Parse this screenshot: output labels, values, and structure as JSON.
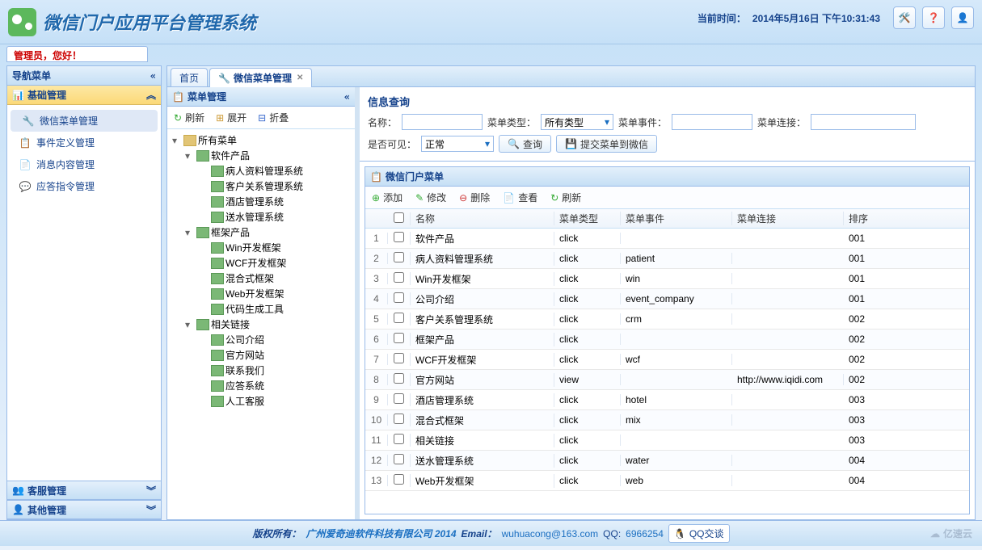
{
  "header": {
    "title": "微信门户应用平台管理系统",
    "time_label": "当前时间：",
    "time_value": "2014年5月16日 下午10:31:43",
    "icons": [
      "tools-icon",
      "help-icon",
      "user-icon"
    ]
  },
  "welcome": {
    "role": "管理员",
    "text": "，您好！"
  },
  "west": {
    "title": "导航菜单",
    "groups": [
      {
        "label": "基础管理",
        "expanded": true,
        "items": [
          {
            "label": "微信菜单管理",
            "active": true,
            "icon": "🔧"
          },
          {
            "label": "事件定义管理",
            "icon": "📋"
          },
          {
            "label": "消息内容管理",
            "icon": "📄"
          },
          {
            "label": "应答指令管理",
            "icon": "💬"
          }
        ]
      },
      {
        "label": "客服管理",
        "expanded": false
      },
      {
        "label": "其他管理",
        "expanded": false
      }
    ]
  },
  "tabs": [
    {
      "label": "首页",
      "closable": false,
      "active": false
    },
    {
      "label": "微信菜单管理",
      "closable": true,
      "active": true
    }
  ],
  "tree": {
    "title": "菜单管理",
    "toolbar": {
      "refresh": "刷新",
      "expand": "展开",
      "collapse": "折叠"
    },
    "root": "所有菜单",
    "nodes": [
      {
        "label": "软件产品",
        "children": [
          "病人资料管理系统",
          "客户关系管理系统",
          "酒店管理系统",
          "送水管理系统"
        ]
      },
      {
        "label": "框架产品",
        "children": [
          "Win开发框架",
          "WCF开发框架",
          "混合式框架",
          "Web开发框架",
          "代码生成工具"
        ]
      },
      {
        "label": "相关链接",
        "children": [
          "公司介绍",
          "官方网站",
          "联系我们",
          "应答系统",
          "人工客服"
        ]
      }
    ]
  },
  "search": {
    "title": "信息查询",
    "labels": {
      "name": "名称：",
      "type": "菜单类型：",
      "event": "菜单事件：",
      "link": "菜单连接：",
      "visible": "是否可见："
    },
    "type_value": "所有类型",
    "visible_value": "正常",
    "btn_search": "查询",
    "btn_submit": "提交菜单到微信"
  },
  "grid": {
    "title": "微信门户菜单",
    "toolbar": {
      "add": "添加",
      "edit": "修改",
      "delete": "删除",
      "view": "查看",
      "refresh": "刷新"
    },
    "columns": {
      "name": "名称",
      "type": "菜单类型",
      "event": "菜单事件",
      "link": "菜单连接",
      "sort": "排序"
    },
    "rows": [
      {
        "idx": 1,
        "name": "软件产品",
        "type": "click",
        "event": "",
        "link": "",
        "sort": "001"
      },
      {
        "idx": 2,
        "name": "病人资料管理系统",
        "type": "click",
        "event": "patient",
        "link": "",
        "sort": "001"
      },
      {
        "idx": 3,
        "name": "Win开发框架",
        "type": "click",
        "event": "win",
        "link": "",
        "sort": "001"
      },
      {
        "idx": 4,
        "name": "公司介绍",
        "type": "click",
        "event": "event_company",
        "link": "",
        "sort": "001"
      },
      {
        "idx": 5,
        "name": "客户关系管理系统",
        "type": "click",
        "event": "crm",
        "link": "",
        "sort": "002"
      },
      {
        "idx": 6,
        "name": "框架产品",
        "type": "click",
        "event": "",
        "link": "",
        "sort": "002"
      },
      {
        "idx": 7,
        "name": "WCF开发框架",
        "type": "click",
        "event": "wcf",
        "link": "",
        "sort": "002"
      },
      {
        "idx": 8,
        "name": "官方网站",
        "type": "view",
        "event": "",
        "link": "http://www.iqidi.com",
        "sort": "002"
      },
      {
        "idx": 9,
        "name": "酒店管理系统",
        "type": "click",
        "event": "hotel",
        "link": "",
        "sort": "003"
      },
      {
        "idx": 10,
        "name": "混合式框架",
        "type": "click",
        "event": "mix",
        "link": "",
        "sort": "003"
      },
      {
        "idx": 11,
        "name": "相关链接",
        "type": "click",
        "event": "",
        "link": "",
        "sort": "003"
      },
      {
        "idx": 12,
        "name": "送水管理系统",
        "type": "click",
        "event": "water",
        "link": "",
        "sort": "004"
      },
      {
        "idx": 13,
        "name": "Web开发框架",
        "type": "click",
        "event": "web",
        "link": "",
        "sort": "004"
      }
    ]
  },
  "footer": {
    "copyright_label": "版权所有：",
    "company": "广州爱奇迪软件科技有限公司 2014",
    "email_label": "Email：",
    "email": "wuhuacong@163.com",
    "qq_label": "QQ:",
    "qq": "6966254",
    "qq_badge": "QQ交谈",
    "watermark": "亿速云"
  }
}
